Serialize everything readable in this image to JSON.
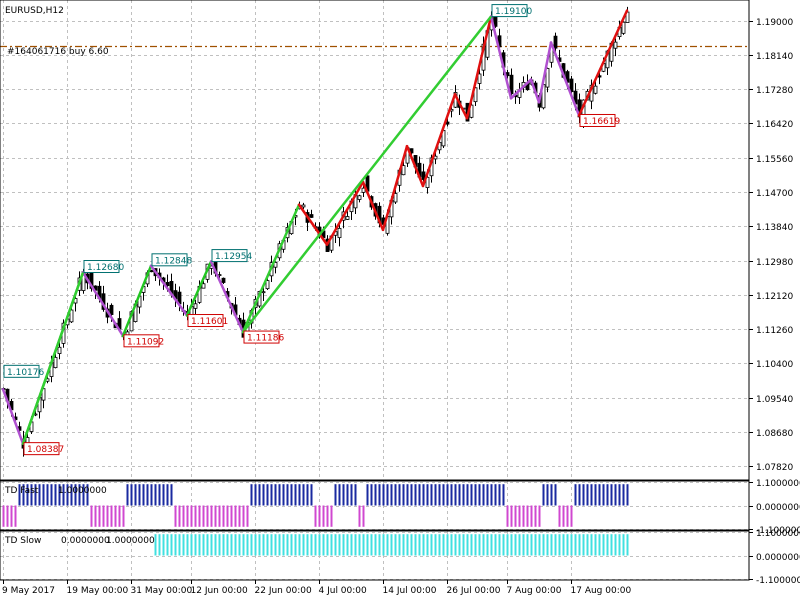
{
  "colors": {
    "background": "#ffffff",
    "grid": "#c0c0c0",
    "candle": "#000000",
    "zigzag_up": "#22c522",
    "zigzag_up_fast": "#32cd32",
    "zigzag_down": "#e01010",
    "zigzag_correction": "#b050d0",
    "high_label": "#007070",
    "low_label": "#d00000",
    "order_line": "#a05000",
    "fast_pos": "#1a2aa0",
    "fast_neg": "#d048d0",
    "slow": "#40e0e0"
  },
  "main_panel": {
    "symbol_timeframe": "EURUSD,H12",
    "order_label": "#164061716 buy 6.60",
    "order_price": 1.18358
  },
  "chart_data": [
    {
      "type": "candlestick",
      "title": "EURUSD,H12",
      "y_ticks": [
        "1.19000",
        "1.18140",
        "1.17280",
        "1.16420",
        "1.15560",
        "1.14700",
        "1.13840",
        "1.12980",
        "1.12120",
        "1.11260",
        "1.10400",
        "1.09540",
        "1.08680",
        "1.07820"
      ],
      "ylim": [
        1.07475,
        1.19516
      ],
      "x_ticks": [
        "9 May 2017",
        "19 May 00:00",
        "31 May 00:00",
        "12 Jun 00:00",
        "22 Jun 00:00",
        "4 Jul 00:00",
        "14 Jul 00:00",
        "26 Jul 00:00",
        "7 Aug 00:00",
        "17 Aug 00:00"
      ],
      "grid": true,
      "swing_points": [
        {
          "type": "high",
          "label": "1.10176",
          "bar": 0
        },
        {
          "type": "low",
          "label": "1.08387",
          "bar": 5
        },
        {
          "type": "high",
          "label": "1.12680",
          "bar": 20
        },
        {
          "type": "low",
          "label": "1.11092",
          "bar": 30
        },
        {
          "type": "high",
          "label": "1.12848",
          "bar": 37
        },
        {
          "type": "low",
          "label": "1.11601",
          "bar": 46
        },
        {
          "type": "high",
          "label": "1.12954",
          "bar": 52
        },
        {
          "type": "low",
          "label": "1.11186",
          "bar": 60
        },
        {
          "type": "high",
          "label": "1.19100",
          "bar": 122
        },
        {
          "type": "low",
          "label": "1.16619",
          "bar": 144
        }
      ],
      "zigzag_path": [
        {
          "bar": 0,
          "price": 1.0975
        },
        {
          "bar": 5,
          "price": 1.08387
        },
        {
          "bar": 20,
          "price": 1.1268
        },
        {
          "bar": 30,
          "price": 1.11092
        },
        {
          "bar": 37,
          "price": 1.12848
        },
        {
          "bar": 46,
          "price": 1.11601
        },
        {
          "bar": 52,
          "price": 1.12954
        },
        {
          "bar": 60,
          "price": 1.11186
        },
        {
          "bar": 74,
          "price": 1.1438
        },
        {
          "bar": 81,
          "price": 1.1338
        },
        {
          "bar": 90,
          "price": 1.1495
        },
        {
          "bar": 95,
          "price": 1.1375
        },
        {
          "bar": 101,
          "price": 1.1585
        },
        {
          "bar": 105,
          "price": 1.1485
        },
        {
          "bar": 113,
          "price": 1.1715
        },
        {
          "bar": 116,
          "price": 1.1655
        },
        {
          "bar": 122,
          "price": 1.191
        },
        {
          "bar": 127,
          "price": 1.1705
        },
        {
          "bar": 132,
          "price": 1.1752
        },
        {
          "bar": 134,
          "price": 1.1695
        },
        {
          "bar": 137,
          "price": 1.1845
        },
        {
          "bar": 144,
          "price": 1.16619
        },
        {
          "bar": 156,
          "price": 1.1925
        }
      ]
    },
    {
      "type": "bar",
      "title": "TD Fast",
      "value_label": "1.0000000",
      "y_ticks": [
        "1.1000000",
        "0.0000000",
        "-1.1000000"
      ],
      "ylim": [
        -1.15,
        1.15
      ],
      "values_by_range": [
        {
          "from": 0,
          "to": 3,
          "value": -1
        },
        {
          "from": 4,
          "to": 21,
          "value": 1
        },
        {
          "from": 22,
          "to": 30,
          "value": -1
        },
        {
          "from": 31,
          "to": 42,
          "value": 1
        },
        {
          "from": 43,
          "to": 61,
          "value": -1
        },
        {
          "from": 62,
          "to": 77,
          "value": 1
        },
        {
          "from": 78,
          "to": 82,
          "value": -1
        },
        {
          "from": 83,
          "to": 88,
          "value": 1
        },
        {
          "from": 89,
          "to": 90,
          "value": -1
        },
        {
          "from": 91,
          "to": 125,
          "value": 1
        },
        {
          "from": 126,
          "to": 134,
          "value": -1
        },
        {
          "from": 135,
          "to": 138,
          "value": 1
        },
        {
          "from": 139,
          "to": 142,
          "value": -1
        },
        {
          "from": 143,
          "to": 156,
          "value": 1
        }
      ]
    },
    {
      "type": "bar",
      "title": "TD Slow",
      "value_labels": [
        "0.0000000",
        "1.0000000"
      ],
      "y_ticks": [
        "1.1000000",
        "0.0000000",
        "-1.1000000"
      ],
      "ylim": [
        -1.15,
        1.15
      ],
      "values_by_range": [
        {
          "from": 0,
          "to": 37,
          "value": 0
        },
        {
          "from": 38,
          "to": 156,
          "value": 1
        }
      ]
    }
  ]
}
